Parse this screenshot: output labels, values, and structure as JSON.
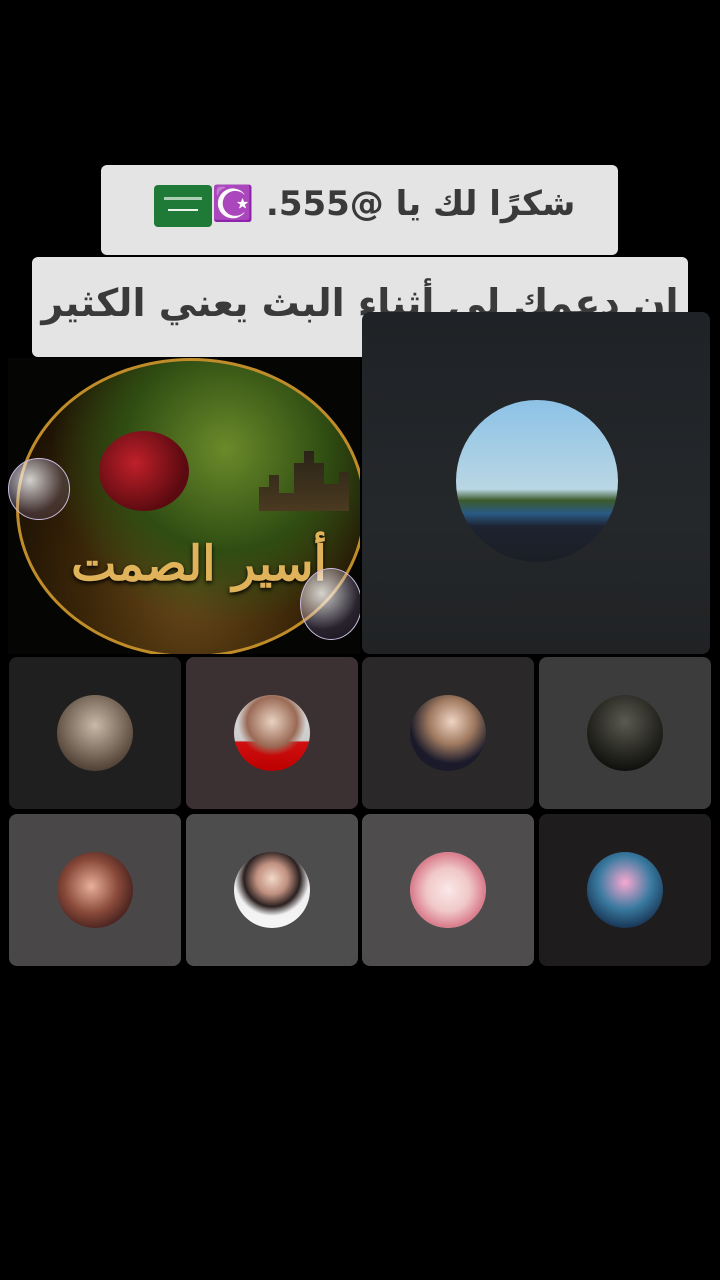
{
  "captions": {
    "line1": "شكرًا لك يا @555. ☪️",
    "line1_flag_icon": "saudi-flag-icon",
    "line2": "إن دعمك لي أثناء البث يعني الكثير"
  },
  "host": {
    "emblem_text": "أسير الصمت",
    "avatar_icon": "host-emblem-image"
  },
  "guests": [
    {
      "avatar_icon": "landscape-avatar"
    },
    {
      "avatar_icon": "user-avatar"
    },
    {
      "avatar_icon": "user-avatar"
    },
    {
      "avatar_icon": "user-avatar"
    },
    {
      "avatar_icon": "user-avatar"
    },
    {
      "avatar_icon": "user-avatar"
    },
    {
      "avatar_icon": "user-avatar"
    },
    {
      "avatar_icon": "user-avatar"
    },
    {
      "avatar_icon": "user-avatar"
    }
  ],
  "colors": {
    "background": "#000000",
    "caption_bg": "#e4e4e4",
    "caption_text": "#3a3a3a"
  }
}
